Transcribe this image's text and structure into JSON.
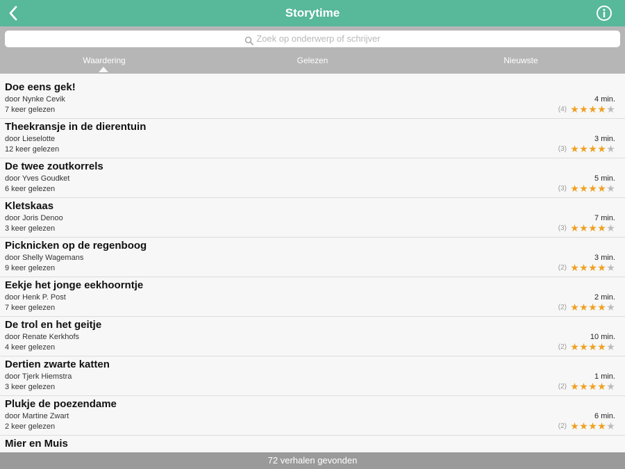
{
  "navbar": {
    "title": "Storytime",
    "back_icon": "chevron-left-icon",
    "info_icon": "info-circle-icon"
  },
  "search": {
    "placeholder": "Zoek op onderwerp of schrijver",
    "icon": "search-icon"
  },
  "tabs": [
    {
      "label": "Waardering",
      "selected": true
    },
    {
      "label": "Gelezen",
      "selected": false
    },
    {
      "label": "Nieuwste",
      "selected": false
    }
  ],
  "stories": [
    {
      "title": "Doe eens gek!",
      "author": "door Nynke Cevik",
      "reads": "7 keer gelezen",
      "duration": "4 min.",
      "rating_count": "(4)",
      "stars": 4
    },
    {
      "title": "Theekransje in de dierentuin",
      "author": "door Lieselotte",
      "reads": "12 keer gelezen",
      "duration": "3 min.",
      "rating_count": "(3)",
      "stars": 4
    },
    {
      "title": "De twee zoutkorrels",
      "author": "door Yves Goudket",
      "reads": "6 keer gelezen",
      "duration": "5 min.",
      "rating_count": "(3)",
      "stars": 4
    },
    {
      "title": "Kletskaas",
      "author": "door Joris Denoo",
      "reads": "3 keer gelezen",
      "duration": "7 min.",
      "rating_count": "(3)",
      "stars": 4
    },
    {
      "title": "Picknicken op de regenboog",
      "author": "door Shelly Wagemans",
      "reads": "9 keer gelezen",
      "duration": "3 min.",
      "rating_count": "(2)",
      "stars": 4
    },
    {
      "title": "Eekje het jonge eekhoorntje",
      "author": "door Henk P. Post",
      "reads": "7 keer gelezen",
      "duration": "2 min.",
      "rating_count": "(2)",
      "stars": 4
    },
    {
      "title": "De trol en het geitje",
      "author": "door Renate Kerkhofs",
      "reads": "4 keer gelezen",
      "duration": "10 min.",
      "rating_count": "(2)",
      "stars": 4
    },
    {
      "title": "Dertien zwarte katten",
      "author": "door Tjerk Hiemstra",
      "reads": "3 keer gelezen",
      "duration": "1 min.",
      "rating_count": "(2)",
      "stars": 4
    },
    {
      "title": "Plukje de poezendame",
      "author": "door Martine Zwart",
      "reads": "2 keer gelezen",
      "duration": "6 min.",
      "rating_count": "(2)",
      "stars": 4
    },
    {
      "title": "Mier en Muis",
      "author": "",
      "reads": "",
      "duration": "",
      "rating_count": "",
      "stars": 0
    }
  ],
  "footer": {
    "text": "72 verhalen gevonden"
  },
  "colors": {
    "navbar": "#57b89a",
    "star_on": "#f0a020",
    "star_off": "#bbbbbb",
    "bar_gray": "#b6b6b6"
  }
}
